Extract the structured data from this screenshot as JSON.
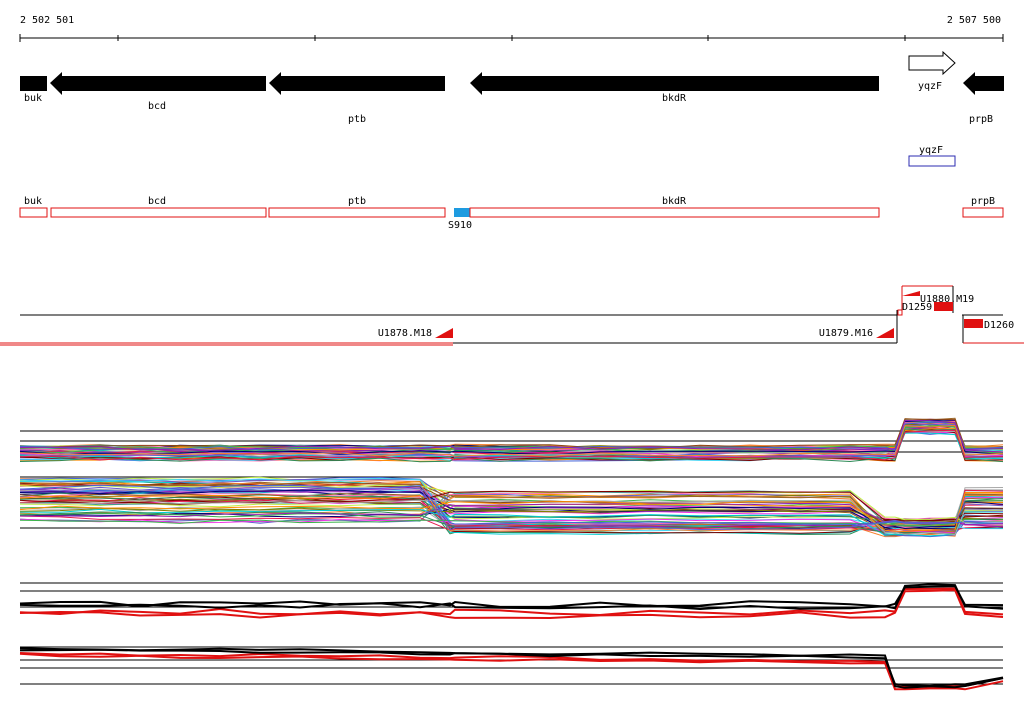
{
  "ruler": {
    "start_label": "2 502 501",
    "end_label": "2 507 500"
  },
  "genes": [
    {
      "label": "buk",
      "strand": "-",
      "style": "filled"
    },
    {
      "label": "bcd",
      "strand": "-",
      "style": "filled"
    },
    {
      "label": "ptb",
      "strand": "-",
      "style": "filled"
    },
    {
      "label": "bkdR",
      "strand": "-",
      "style": "filled"
    },
    {
      "label": "yqzF",
      "strand": "+",
      "style": "open"
    },
    {
      "label": "prpB",
      "strand": "-",
      "style": "filled"
    }
  ],
  "upper_boxes": [
    {
      "label": "yqzF",
      "color": "#2b2bb0"
    }
  ],
  "lower_boxes": [
    {
      "label": "buk",
      "color": "#e01010"
    },
    {
      "label": "bcd",
      "color": "#e01010"
    },
    {
      "label": "ptb",
      "color": "#e01010"
    },
    {
      "label": "S910",
      "color": "#1e9be0"
    },
    {
      "label": "bkdR",
      "color": "#e01010"
    },
    {
      "label": "prpB",
      "color": "#e01010"
    }
  ],
  "segments": [
    {
      "label": "U1878.M18"
    },
    {
      "label": "U1879.M16"
    },
    {
      "label": "U1880.M19"
    },
    {
      "label": "D1259"
    },
    {
      "label": "D1260"
    }
  ],
  "colors": {
    "gene_fill": "#000000",
    "feature_red": "#e01010",
    "feature_blue": "#1e9be0",
    "box_blue": "#2b2bb0"
  }
}
